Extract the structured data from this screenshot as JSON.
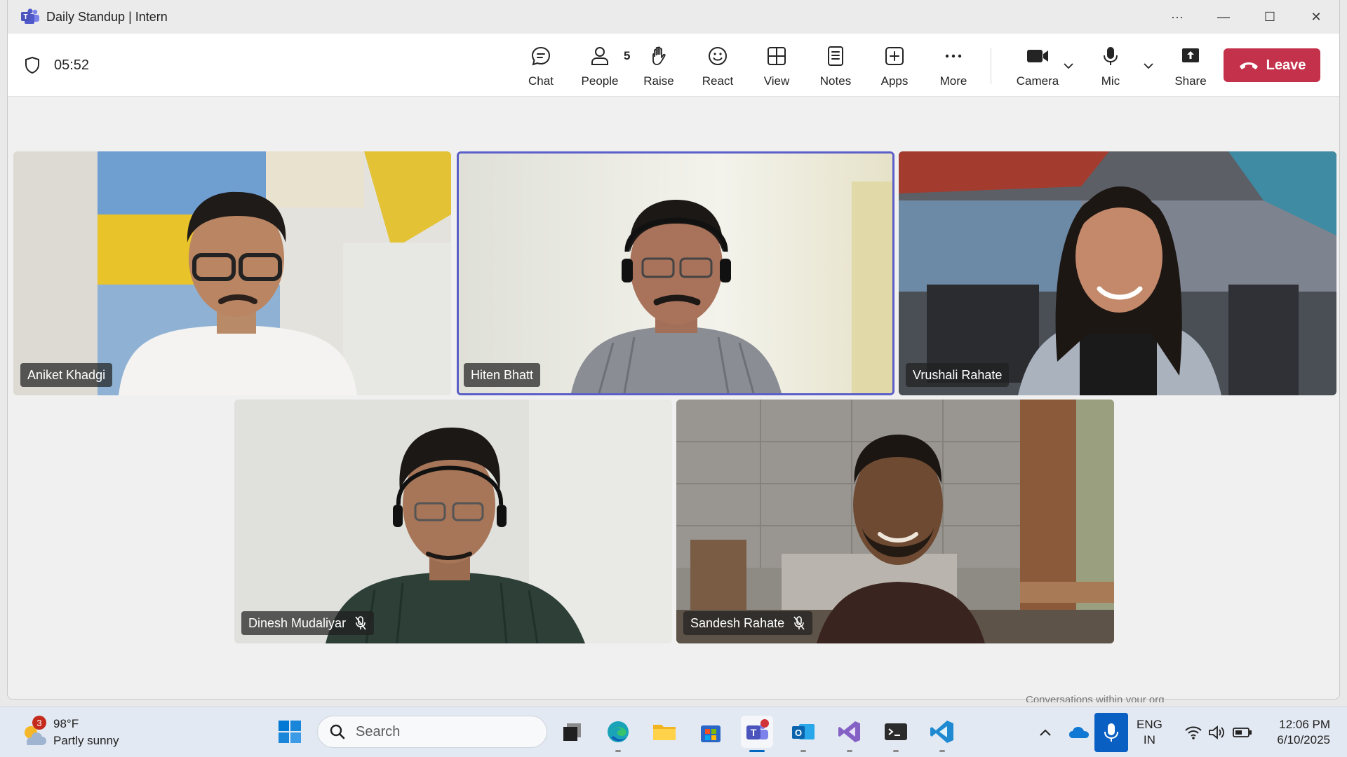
{
  "window": {
    "title": "Daily Standup | Intern",
    "controls": {
      "more": "···",
      "minimize": "—",
      "maximize": "☐",
      "close": "✕"
    }
  },
  "toolbar": {
    "timer": "05:52",
    "chat_label": "Chat",
    "people_label": "People",
    "people_count": "5",
    "raise_label": "Raise",
    "react_label": "React",
    "view_label": "View",
    "notes_label": "Notes",
    "apps_label": "Apps",
    "more_label": "More",
    "camera_label": "Camera",
    "mic_label": "Mic",
    "share_label": "Share",
    "leave_label": "Leave"
  },
  "participants": [
    {
      "name": "Aniket Khadgi",
      "muted": false,
      "active": false
    },
    {
      "name": "Hiten Bhatt",
      "muted": false,
      "active": true
    },
    {
      "name": "Vrushali Rahate",
      "muted": false,
      "active": false
    },
    {
      "name": "Dinesh Mudaliyar",
      "muted": true,
      "active": false
    },
    {
      "name": "Sandesh Rahate",
      "muted": true,
      "active": false
    }
  ],
  "notification_peek": "Conversations within your org",
  "taskbar": {
    "weather_badge": "3",
    "weather_temp": "98°F",
    "weather_desc": "Partly sunny",
    "search_placeholder": "Search",
    "apps": [
      "start-icon",
      "task-view-icon",
      "edge-icon",
      "file-explorer-icon",
      "store-icon",
      "teams-icon",
      "outlook-icon",
      "visual-studio-icon",
      "terminal-icon",
      "vscode-icon"
    ],
    "lang_top": "ENG",
    "lang_bottom": "IN",
    "time": "12:06 PM",
    "date": "6/10/2025"
  },
  "colors": {
    "leave": "#c4314b",
    "active_border": "#5b5fc7",
    "teams_purple": "#5b5fc7"
  }
}
